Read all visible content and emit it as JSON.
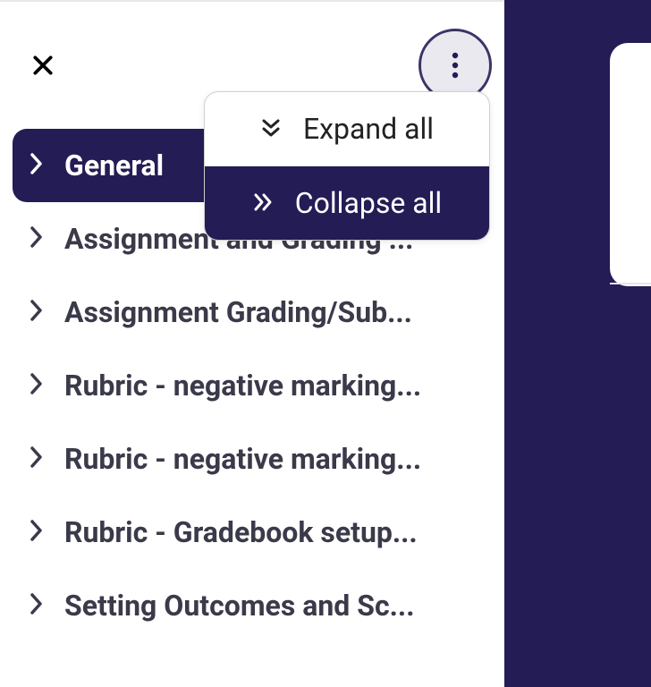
{
  "dropdown": {
    "expand_label": "Expand all",
    "collapse_label": "Collapse all"
  },
  "nav": {
    "items": [
      {
        "label": "General",
        "active": true
      },
      {
        "label": "Assignment and Grading ..."
      },
      {
        "label": "Assignment Grading/Sub..."
      },
      {
        "label": "Rubric - negative marking..."
      },
      {
        "label": "Rubric - negative marking..."
      },
      {
        "label": "Rubric - Gradebook setup..."
      },
      {
        "label": "Setting Outcomes and Sc..."
      }
    ]
  }
}
